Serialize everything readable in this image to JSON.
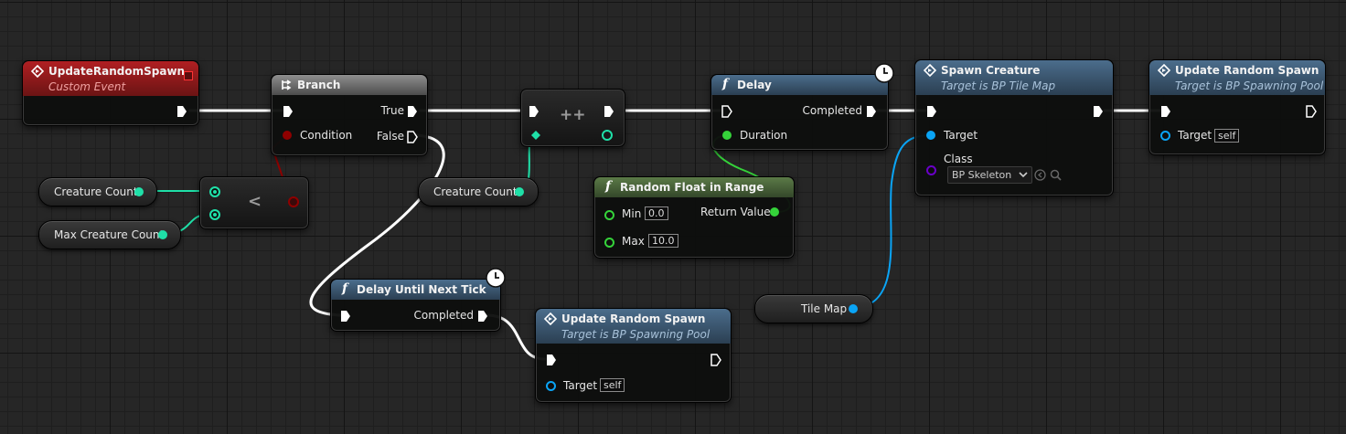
{
  "nodes": {
    "custom_event": {
      "title": "UpdateRandomSpawn",
      "subtitle": "Custom Event"
    },
    "branch": {
      "title": "Branch",
      "condition": "Condition",
      "true_label": "True",
      "false_label": "False"
    },
    "increment": {
      "symbol": "++"
    },
    "compare": {
      "symbol": "<"
    },
    "creature_count_a": {
      "label": "Creature Count"
    },
    "max_creature_count": {
      "label": "Max Creature Count"
    },
    "creature_count_b": {
      "label": "Creature Count"
    },
    "delay": {
      "title": "Delay",
      "completed": "Completed",
      "duration": "Duration"
    },
    "random_float": {
      "title": "Random Float in Range",
      "min_label": "Min",
      "min_value": "0.0",
      "max_label": "Max",
      "max_value": "10.0",
      "return_value": "Return Value"
    },
    "spawn_creature": {
      "title": "Spawn Creature",
      "subtitle": "Target is BP Tile Map",
      "target": "Target",
      "class_label": "Class",
      "class_value": "BP Skeleton"
    },
    "update_random_spawn_1": {
      "title": "Update Random Spawn",
      "subtitle": "Target is BP Spawning Pool",
      "target": "Target",
      "self": "self"
    },
    "delay_next_tick": {
      "title": "Delay Until Next Tick",
      "completed": "Completed"
    },
    "update_random_spawn_2": {
      "title": "Update Random Spawn",
      "subtitle": "Target is BP Spawning Pool",
      "target": "Target",
      "self": "self"
    },
    "tile_map": {
      "label": "Tile Map"
    }
  },
  "colors": {
    "exec_wire": "#ffffff",
    "int_pin": "#1fe0a8",
    "float_pin": "#35d33a",
    "object_pin": "#0aa4f5",
    "bool_pin": "#8f0000",
    "class_pin": "#6a00c8",
    "event_header": "#b01f22",
    "function_header": "#4b6d8c",
    "pure_function_header": "#5b7a47",
    "macro_header": "#8e8e8e"
  },
  "icons": {
    "event": "diamond-arrow-icon",
    "branch": "branch-icon",
    "function": "function-f-icon",
    "latent": "clock-icon"
  }
}
